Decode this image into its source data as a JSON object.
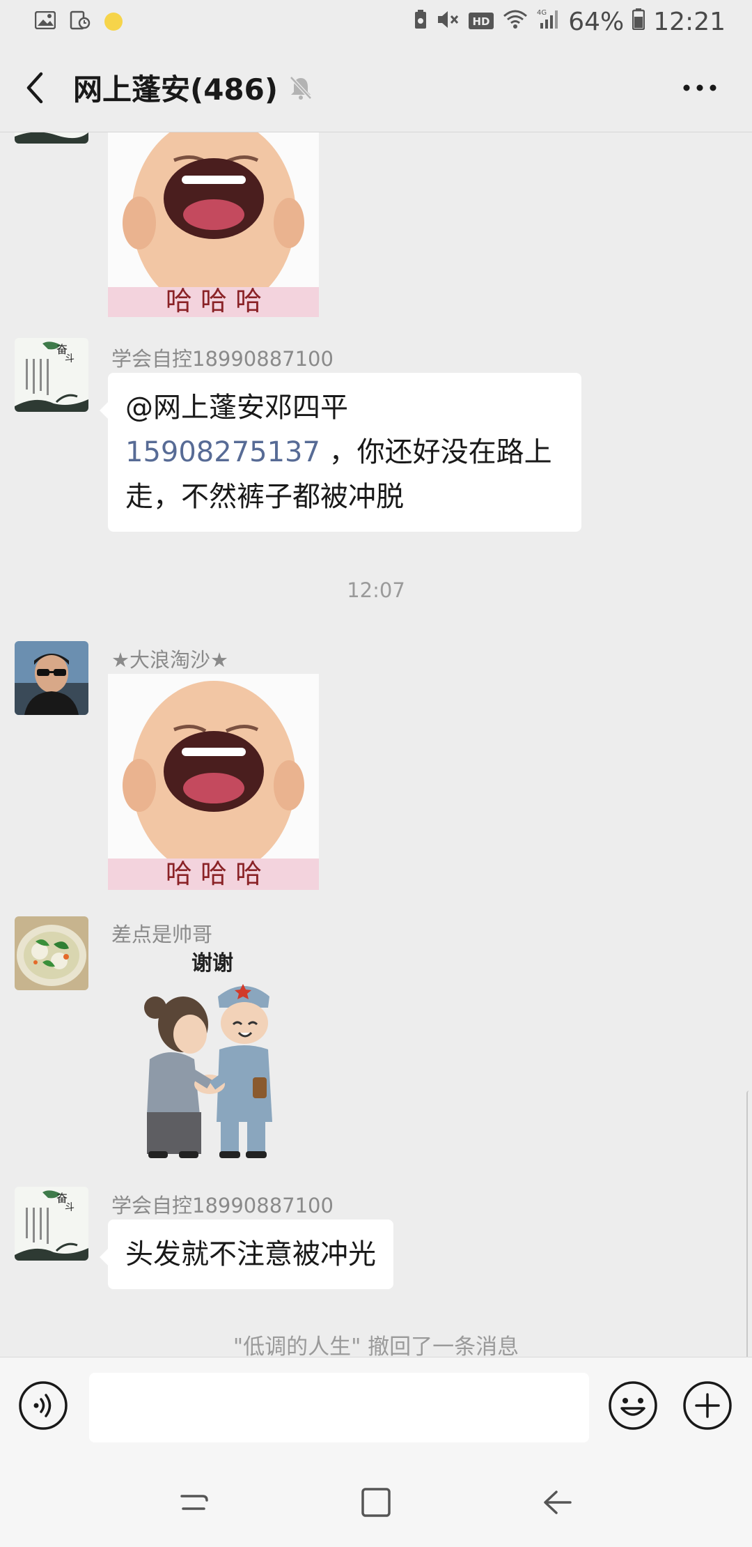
{
  "status_bar": {
    "battery": "64%",
    "time": "12:21",
    "network": "4G",
    "hd_label": "HD"
  },
  "header": {
    "title": "网上蓬安(486)"
  },
  "messages": [
    {
      "type": "sticker",
      "sticker_caption": "哈 哈 哈",
      "sticker_icon": "laughing-baby-sticker"
    },
    {
      "type": "text",
      "sender": "学会自控18990887100",
      "avatar_icon": "fendou-calligraphy-avatar",
      "mention": "@网上蓬安邓四平",
      "phone": "15908275137",
      "line2_rest": " ，你还好没在路上",
      "line3": "走，不然裤子都被冲脱"
    },
    {
      "type": "time",
      "text": "12:07"
    },
    {
      "type": "sticker",
      "sender": "★大浪淘沙★",
      "avatar_icon": "man-sunglasses-avatar",
      "sticker_caption": "哈 哈 哈",
      "sticker_icon": "laughing-baby-sticker"
    },
    {
      "type": "sticker",
      "sender": "差点是帅哥",
      "avatar_icon": "vegetable-soup-avatar",
      "sticker_caption": "谢谢",
      "sticker_icon": "handshake-soldier-sticker"
    },
    {
      "type": "text",
      "sender": "学会自控18990887100",
      "avatar_icon": "fendou-calligraphy-avatar",
      "text": "头发就不注意被冲光"
    },
    {
      "type": "system",
      "text": "\"低调的人生\" 撤回了一条消息"
    }
  ],
  "input_bar": {
    "placeholder": "",
    "voice_icon": "voice-icon",
    "emoji_icon": "emoji-icon",
    "plus_icon": "plus-icon"
  },
  "nav_bar": {
    "recent_icon": "recent-apps-icon",
    "home_icon": "home-icon",
    "back_icon": "back-icon"
  }
}
